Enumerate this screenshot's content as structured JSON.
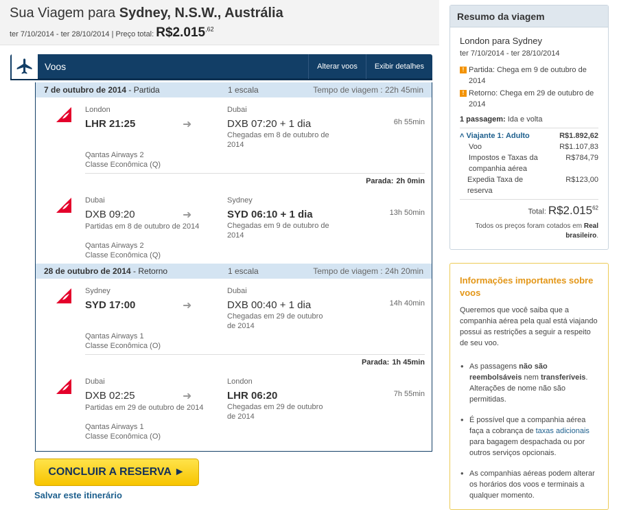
{
  "header": {
    "title_prefix": "Sua Viagem para ",
    "title_dest": "Sydney, N.S.W., Austrália",
    "dates": "ter 7/10/2014 - ter 28/10/2014",
    "price_label": "Preço total:",
    "price_main": "R$2.015",
    "price_cents": ",62"
  },
  "flights_bar": {
    "title": "Voos",
    "change_label": "Alterar voos",
    "details_label": "Exibir detalhes"
  },
  "legs": [
    {
      "date": "7 de outubro de 2014",
      "kind": "- Partida",
      "stops": "1 escala",
      "travel_time": "Tempo de viagem : 22h 45min",
      "segments": [
        {
          "from": "London",
          "from_code": "LHR 21:25",
          "from_note": "",
          "to": "Dubai",
          "to_code": "DXB 07:20 + 1 dia",
          "to_note": "Chegadas em 8 de outubro de 2014",
          "duration": "6h 55min",
          "airline": "Qantas Airways 2",
          "cabin": "Classe Econômica (Q)"
        },
        {
          "from": "Dubai",
          "from_code": "DXB 09:20",
          "from_note": "Partidas em 8 de outubro de 2014",
          "to": "Sydney",
          "to_code": "SYD 06:10 + 1 dia",
          "to_note": "Chegadas em 9 de outubro de 2014",
          "duration": "13h 50min",
          "airline": "Qantas Airways 2",
          "cabin": "Classe Econômica (Q)"
        }
      ],
      "layover_label": "Parada:",
      "layover": "2h 0min"
    },
    {
      "date": "28 de outubro de 2014",
      "kind": "- Retorno",
      "stops": "1 escala",
      "travel_time": "Tempo de viagem : 24h 20min",
      "segments": [
        {
          "from": "Sydney",
          "from_code": "SYD 17:00",
          "from_note": "",
          "to": "Dubai",
          "to_code": "DXB 00:40 + 1 dia",
          "to_note": "Chegadas em 29 de outubro de 2014",
          "duration": "14h 40min",
          "airline": "Qantas Airways 1",
          "cabin": "Classe Econômica (O)"
        },
        {
          "from": "Dubai",
          "from_code": "DXB 02:25",
          "from_note": "Partidas em 29 de outubro de 2014",
          "to": "London",
          "to_code": "LHR 06:20",
          "to_note": "Chegadas em 29 de outubro de 2014",
          "duration": "7h 55min",
          "airline": "Qantas Airways 1",
          "cabin": "Classe Econômica (O)"
        }
      ],
      "layover_label": "Parada:",
      "layover": "1h 45min"
    }
  ],
  "cta": {
    "book_label": "CONCLUIR A RESERVA ►",
    "save_label": "Salvar este itinerário"
  },
  "summary": {
    "title": "Resumo da viagem",
    "route": "London para Sydney",
    "dates": "ter 7/10/2014 - ter 28/10/2014",
    "warn_departure": "Partida: Chega em 9 de outubro de 2014",
    "warn_return": "Retorno: Chega em 29 de outubro de 2014",
    "passengers_bold": "1 passagem:",
    "passengers_rest": " Ida e volta",
    "traveler_label": "Viajante 1: Adulto",
    "traveler_amount": "R$1.892,62",
    "items": [
      {
        "label": "Voo",
        "amount": "R$1.107,83"
      },
      {
        "label": "Impostos e Taxas da companhia aérea",
        "amount": "R$784,79"
      },
      {
        "label": "Expedia Taxa de reserva",
        "amount": "R$123,00"
      }
    ],
    "total_label": "Total:",
    "total_main": "R$2.015",
    "total_cents": "62",
    "note_prefix": "Todos os preços foram cotados em ",
    "note_bold": "Real brasileiro",
    "note_suffix": "."
  },
  "info": {
    "title": "Informações importantes sobre voos",
    "intro": "Queremos que você saiba que a companhia aérea pela qual está viajando possui as restrições a seguir a respeito de seu voo.",
    "b1_pre": "As passagens ",
    "b1_bold1": "não são reembolsáveis",
    "b1_mid": " nem ",
    "b1_bold2": "transferíveis",
    "b1_post": ". Alterações de nome não são permitidas.",
    "b2_pre": "É possível que a companhia aérea faça a cobrança de ",
    "b2_link": "taxas adicionais",
    "b2_post": " para bagagem despachada ou por outros serviços opcionais.",
    "b3": "As companhias aéreas podem alterar os horários dos voos e terminais a qualquer momento."
  },
  "colors": {
    "brand_navy": "#123e66",
    "leg_header": "#d4e4f2",
    "cta_yellow": "#f7c400",
    "warning_orange": "#f39200",
    "info_title": "#e39617",
    "qantas_red": "#e4002b"
  },
  "icons": {
    "flights": "airplane-icon",
    "airline": "qantas-kangaroo-logo",
    "warning": "warning-icon",
    "arrow": "arrow-right-icon"
  }
}
